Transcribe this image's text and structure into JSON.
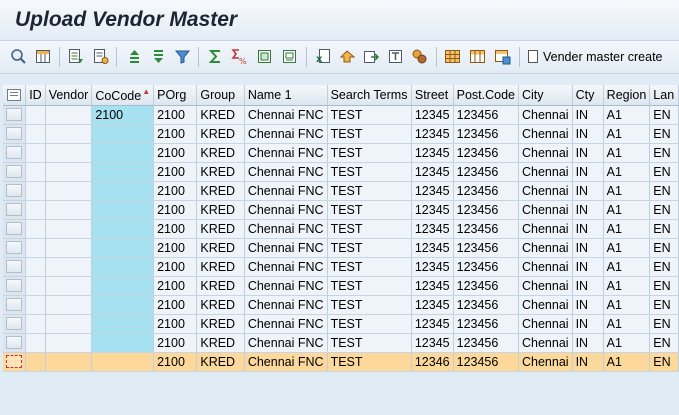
{
  "app": {
    "title": "Upload Vendor Master",
    "colors": {
      "cocode_column": "#a6e1f1",
      "highlight_row": "#fcd99a",
      "grid_cell": "#eef4fa",
      "background": "#dfebf5"
    }
  },
  "toolbar": {
    "icons": [
      "details-icon",
      "select-layout-icon",
      "row-details-icon",
      "row-details-2-icon",
      "sort-ascending-icon",
      "sort-descending-icon",
      "filter-icon",
      "sum-icon",
      "subtotal-icon",
      "print-icon",
      "print-preview-icon",
      "export-spreadsheet-icon",
      "local-file-icon",
      "send-icon",
      "abc-analysis-icon",
      "graphic-icon",
      "change-layout-icon",
      "select-layout-2-icon",
      "save-layout-icon"
    ],
    "vendor_button_label": "Vender master create"
  },
  "grid": {
    "columns": [
      "",
      "ID",
      "Vendor",
      "CoCode",
      "POrg",
      "Group",
      "Name 1",
      "Search Terms",
      "Street",
      "Post.Code",
      "City",
      "Cty",
      "Region",
      "Lan"
    ],
    "cocode_sort_marker": "▲",
    "rows": [
      [
        "",
        "",
        "2100",
        "2100",
        "KRED",
        "Chennai FNC",
        "TEST",
        "12345",
        "123456",
        "Chennai",
        "IN",
        "A1",
        "EN"
      ],
      [
        "",
        "",
        "",
        "2100",
        "KRED",
        "Chennai FNC",
        "TEST",
        "12345",
        "123456",
        "Chennai",
        "IN",
        "A1",
        "EN"
      ],
      [
        "",
        "",
        "",
        "2100",
        "KRED",
        "Chennai FNC",
        "TEST",
        "12345",
        "123456",
        "Chennai",
        "IN",
        "A1",
        "EN"
      ],
      [
        "",
        "",
        "",
        "2100",
        "KRED",
        "Chennai FNC",
        "TEST",
        "12345",
        "123456",
        "Chennai",
        "IN",
        "A1",
        "EN"
      ],
      [
        "",
        "",
        "",
        "2100",
        "KRED",
        "Chennai FNC",
        "TEST",
        "12345",
        "123456",
        "Chennai",
        "IN",
        "A1",
        "EN"
      ],
      [
        "",
        "",
        "",
        "2100",
        "KRED",
        "Chennai FNC",
        "TEST",
        "12345",
        "123456",
        "Chennai",
        "IN",
        "A1",
        "EN"
      ],
      [
        "",
        "",
        "",
        "2100",
        "KRED",
        "Chennai FNC",
        "TEST",
        "12345",
        "123456",
        "Chennai",
        "IN",
        "A1",
        "EN"
      ],
      [
        "",
        "",
        "",
        "2100",
        "KRED",
        "Chennai FNC",
        "TEST",
        "12345",
        "123456",
        "Chennai",
        "IN",
        "A1",
        "EN"
      ],
      [
        "",
        "",
        "",
        "2100",
        "KRED",
        "Chennai FNC",
        "TEST",
        "12345",
        "123456",
        "Chennai",
        "IN",
        "A1",
        "EN"
      ],
      [
        "",
        "",
        "",
        "2100",
        "KRED",
        "Chennai FNC",
        "TEST",
        "12345",
        "123456",
        "Chennai",
        "IN",
        "A1",
        "EN"
      ],
      [
        "",
        "",
        "",
        "2100",
        "KRED",
        "Chennai FNC",
        "TEST",
        "12345",
        "123456",
        "Chennai",
        "IN",
        "A1",
        "EN"
      ],
      [
        "",
        "",
        "",
        "2100",
        "KRED",
        "Chennai FNC",
        "TEST",
        "12345",
        "123456",
        "Chennai",
        "IN",
        "A1",
        "EN"
      ],
      [
        "",
        "",
        "",
        "2100",
        "KRED",
        "Chennai FNC",
        "TEST",
        "12345",
        "123456",
        "Chennai",
        "IN",
        "A1",
        "EN"
      ],
      [
        "",
        "",
        "",
        "2100",
        "KRED",
        "Chennai FNC",
        "TEST",
        "12346",
        "123456",
        "Chennai",
        "IN",
        "A1",
        "EN"
      ]
    ],
    "highlighted_row": 13
  }
}
